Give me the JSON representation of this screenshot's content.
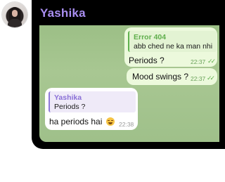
{
  "contact": {
    "name": "Yashika"
  },
  "messages": [
    {
      "direction": "outgoing",
      "reply_to": {
        "name": "Error 404",
        "text": "abb ched ne ka man nhi"
      },
      "text": "Periods ?",
      "time": "22:37",
      "status": "read"
    },
    {
      "direction": "outgoing",
      "text": "Mood swings ?",
      "time": "22:37",
      "status": "read"
    },
    {
      "direction": "incoming",
      "reply_to": {
        "name": "Yashika",
        "text": "Periods ?"
      },
      "text": "ha periods hai",
      "emoji": "grinning-sweat-face-icon",
      "time": "22:38"
    }
  ],
  "colors": {
    "name_accent": "#a98ef0",
    "chat_background": "#a8c792",
    "outgoing_bubble": "#ecf9dc",
    "incoming_bubble": "#ffffff"
  }
}
